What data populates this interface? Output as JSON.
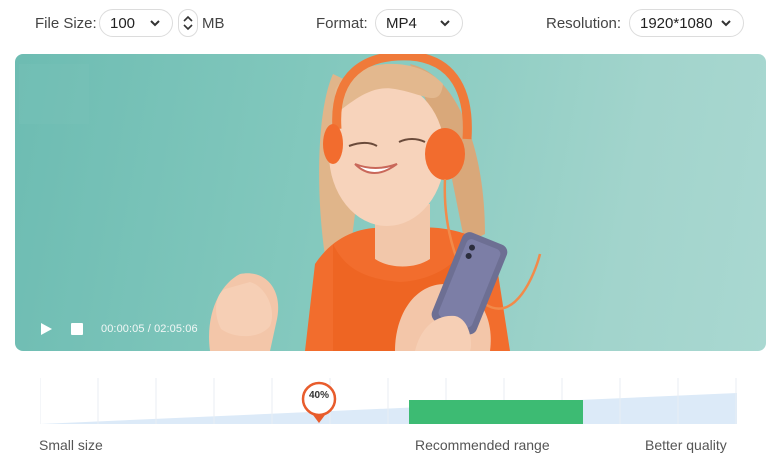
{
  "toolbar": {
    "file_size_label": "File Size:",
    "file_size_value": "100",
    "file_size_unit": "MB",
    "format_label": "Format:",
    "format_value": "MP4",
    "resolution_label": "Resolution:",
    "resolution_value": "1920*1080"
  },
  "player": {
    "timecode": "00:00:05 / 02:05:06"
  },
  "quality_slider": {
    "value_label": "40%",
    "value": 0.4,
    "recommended_range": [
      0.53,
      0.78
    ],
    "left_label": "Small size",
    "middle_label": "Recommended range",
    "right_label": "Better quality"
  },
  "colors": {
    "accent": "#e85c2c",
    "recommended": "#3dbb73",
    "track": "#dceaf8"
  }
}
